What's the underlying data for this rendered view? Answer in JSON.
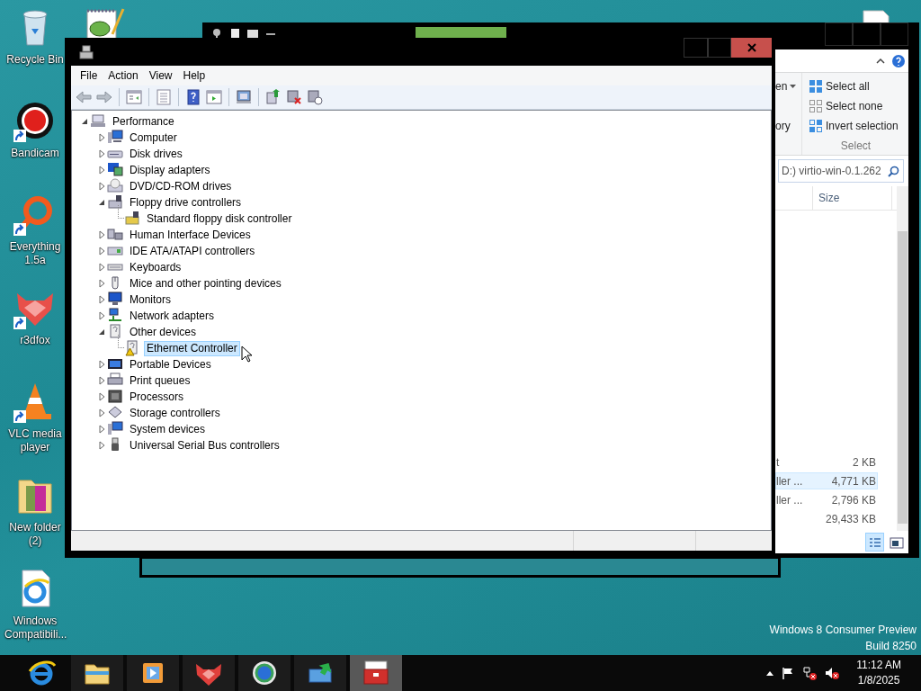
{
  "desktop_icons": [
    {
      "label": "Recycle Bin",
      "kind": "recycle",
      "shortcut": false
    },
    {
      "label": "Bandicam",
      "kind": "record",
      "shortcut": true
    },
    {
      "label": "Everything 1.5a",
      "kind": "magnifier",
      "shortcut": true
    },
    {
      "label": "r3dfox",
      "kind": "fox",
      "shortcut": true
    },
    {
      "label": "VLC media player",
      "kind": "cone",
      "shortcut": true
    },
    {
      "label": "New folder (2)",
      "kind": "folder",
      "shortcut": false
    },
    {
      "label": "Windows Compatibili...",
      "kind": "document",
      "shortcut": false
    }
  ],
  "explorer_window": {
    "ribbon": {
      "partial_commands": [
        {
          "text": "en",
          "dropdown": true
        },
        {
          "text": "ory",
          "dropdown": false
        }
      ],
      "select_group": {
        "commands": [
          {
            "text": "Select all",
            "kind": "all"
          },
          {
            "text": "Select none",
            "kind": "none"
          },
          {
            "text": "Invert selection",
            "kind": "invert"
          }
        ],
        "label": "Select"
      }
    },
    "search": {
      "value": "D:) virtio-win-0.1.262"
    },
    "columns": [
      "Size"
    ],
    "rows": [
      {
        "name": "t",
        "size": "2 KB",
        "hovered": false
      },
      {
        "name": "ller ...",
        "size": "4,771 KB",
        "hovered": true
      },
      {
        "name": "ller ...",
        "size": "2,796 KB",
        "hovered": false
      },
      {
        "size": "29,433 KB",
        "hovered": false
      }
    ],
    "view_buttons": [
      {
        "kind": "details",
        "selected": true
      },
      {
        "kind": "thumbnails",
        "selected": false
      }
    ]
  },
  "device_manager": {
    "menu": [
      "File",
      "Action",
      "View",
      "Help"
    ],
    "tree": {
      "label": "Performance",
      "kind": "root",
      "expanded": true,
      "selected": false,
      "children": [
        {
          "label": "Computer",
          "kind": "computer",
          "expanded": false,
          "selected": false
        },
        {
          "label": "Disk drives",
          "kind": "disk",
          "expanded": false,
          "selected": false
        },
        {
          "label": "Display adapters",
          "kind": "display",
          "expanded": false,
          "selected": false
        },
        {
          "label": "DVD/CD-ROM drives",
          "kind": "dvd",
          "expanded": false,
          "selected": false
        },
        {
          "label": "Floppy drive controllers",
          "kind": "floppy",
          "expanded": true,
          "selected": false,
          "children": [
            {
              "label": "Standard floppy disk controller",
              "kind": "floppyctl",
              "selected": false,
              "warning": false
            }
          ]
        },
        {
          "label": "Human Interface Devices",
          "kind": "hid",
          "expanded": false,
          "selected": false
        },
        {
          "label": "IDE ATA/ATAPI controllers",
          "kind": "ide",
          "expanded": false,
          "selected": false
        },
        {
          "label": "Keyboards",
          "kind": "keyboard",
          "expanded": false,
          "selected": false
        },
        {
          "label": "Mice and other pointing devices",
          "kind": "mouse",
          "expanded": false,
          "selected": false
        },
        {
          "label": "Monitors",
          "kind": "monitor",
          "expanded": false,
          "selected": false
        },
        {
          "label": "Network adapters",
          "kind": "network",
          "expanded": false,
          "selected": false
        },
        {
          "label": "Other devices",
          "kind": "other",
          "expanded": true,
          "selected": false,
          "children": [
            {
              "label": "Ethernet Controller",
              "kind": "other",
              "selected": true,
              "warning": true
            }
          ]
        },
        {
          "label": "Portable Devices",
          "kind": "portable",
          "expanded": false,
          "selected": false
        },
        {
          "label": "Print queues",
          "kind": "printer",
          "expanded": false,
          "selected": false
        },
        {
          "label": "Processors",
          "kind": "processor",
          "expanded": false,
          "selected": false
        },
        {
          "label": "Storage controllers",
          "kind": "storage",
          "expanded": false,
          "selected": false
        },
        {
          "label": "System devices",
          "kind": "system",
          "expanded": false,
          "selected": false
        },
        {
          "label": "Universal Serial Bus controllers",
          "kind": "usb",
          "expanded": false,
          "selected": false
        }
      ]
    }
  },
  "desktop_text": [
    "Windows 8 Consumer Preview",
    "Build 8250"
  ],
  "taskbar": {
    "apps": [
      {
        "kind": "ie",
        "running": false,
        "active": false
      },
      {
        "kind": "explorer",
        "running": true,
        "active": false
      },
      {
        "kind": "media",
        "running": true,
        "active": false
      },
      {
        "kind": "fox",
        "running": true,
        "active": false
      },
      {
        "kind": "globe",
        "running": true,
        "active": false
      },
      {
        "kind": "transfer",
        "running": true,
        "active": false
      },
      {
        "kind": "toolbox",
        "running": true,
        "active": true
      }
    ],
    "clock": {
      "time": "11:12 AM",
      "date": "1/8/2025"
    }
  }
}
